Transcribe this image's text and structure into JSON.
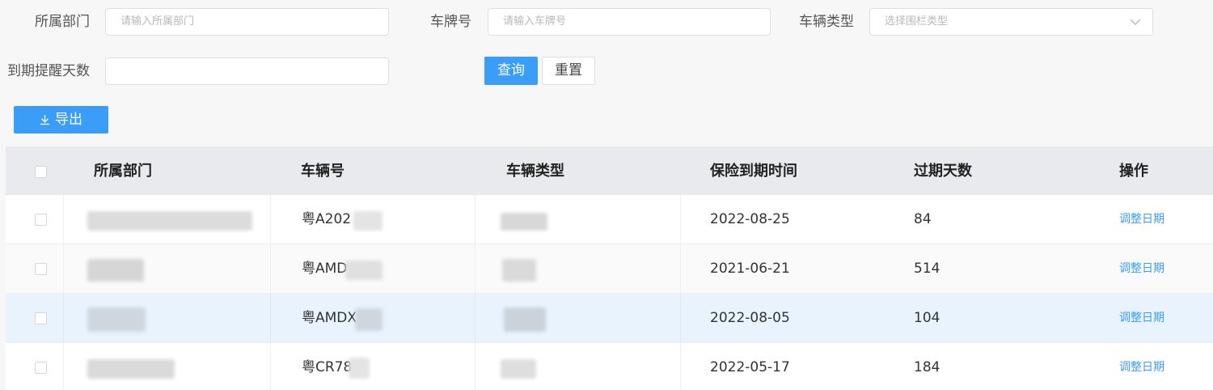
{
  "filters": {
    "department": {
      "label": "所属部门",
      "placeholder": "请输入所属部门"
    },
    "plate": {
      "label": "车牌号",
      "placeholder": "请输入车牌号"
    },
    "vehicle_type": {
      "label": "车辆类型",
      "placeholder": "选择围栏类型"
    },
    "reminder_days": {
      "label": "到期提醒天数",
      "value": ""
    }
  },
  "buttons": {
    "query": "查询",
    "reset": "重置",
    "export": "导出"
  },
  "table": {
    "columns": [
      "所属部门",
      "车辆号",
      "车辆类型",
      "保险到期时间",
      "过期天数",
      "操作"
    ],
    "rows": [
      {
        "department": "",
        "plate": "粤A202",
        "type": "",
        "expiry": "2022-08-25",
        "days": "84",
        "action": "调整日期"
      },
      {
        "department": "",
        "plate": "粤AMD",
        "type": "",
        "expiry": "2021-06-21",
        "days": "514",
        "action": "调整日期"
      },
      {
        "department": "",
        "plate": "粤AMDX",
        "type": "",
        "expiry": "2022-08-05",
        "days": "104",
        "action": "调整日期"
      },
      {
        "department": "",
        "plate": "粤CR78",
        "type": "",
        "expiry": "2022-05-17",
        "days": "184",
        "action": "调整日期"
      }
    ]
  },
  "colors": {
    "primary": "#3a9df7",
    "header_bg": "#e9eaed",
    "highlight_row": "#e8f3fe"
  }
}
